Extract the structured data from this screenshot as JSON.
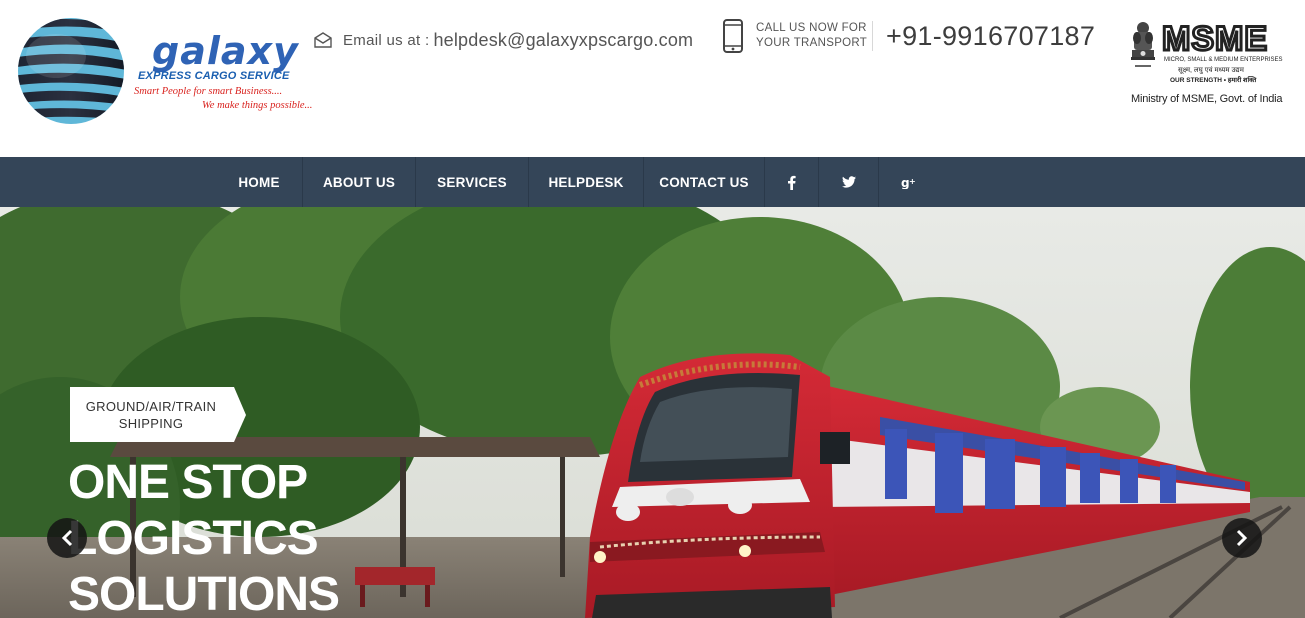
{
  "brand": {
    "name": "galaxy",
    "subtitle": "EXPRESS CARGO SERVICE",
    "tagline_1": "Smart People for smart Business....",
    "tagline_2": "We make things possible..."
  },
  "contact": {
    "email_label": "Email us at :",
    "email": "helpdesk@galaxyxpscargo.com",
    "call_label": "CALL US NOW FOR YOUR TRANSPORT",
    "phone": "+91-9916707187"
  },
  "msme": {
    "logo_text": "MSME",
    "line_1": "MICRO, SMALL & MEDIUM ENTERPRISES",
    "line_2": "सूक्ष्म, लघु एवं मध्यम उद्यम",
    "line_3": "OUR STRENGTH • हमारी शक्ति",
    "caption": "Ministry of MSME, Govt. of India"
  },
  "nav": {
    "items": [
      {
        "label": "HOME"
      },
      {
        "label": "ABOUT US"
      },
      {
        "label": "SERVICES"
      },
      {
        "label": "HELPDESK"
      },
      {
        "label": "CONTACT US"
      }
    ],
    "social": [
      "facebook-icon",
      "twitter-icon",
      "google-plus-icon"
    ]
  },
  "hero": {
    "badge_line_1": "GROUND/AIR/TRAIN",
    "badge_line_2": "SHIPPING",
    "headline": [
      "ONE STOP",
      "LOGISTICS",
      "SOLUTIONS"
    ]
  },
  "colors": {
    "nav_bg": "#344558",
    "brand_blue": "#2f63b5",
    "tagline_red": "#d9231f",
    "train_red": "#c8202d"
  }
}
